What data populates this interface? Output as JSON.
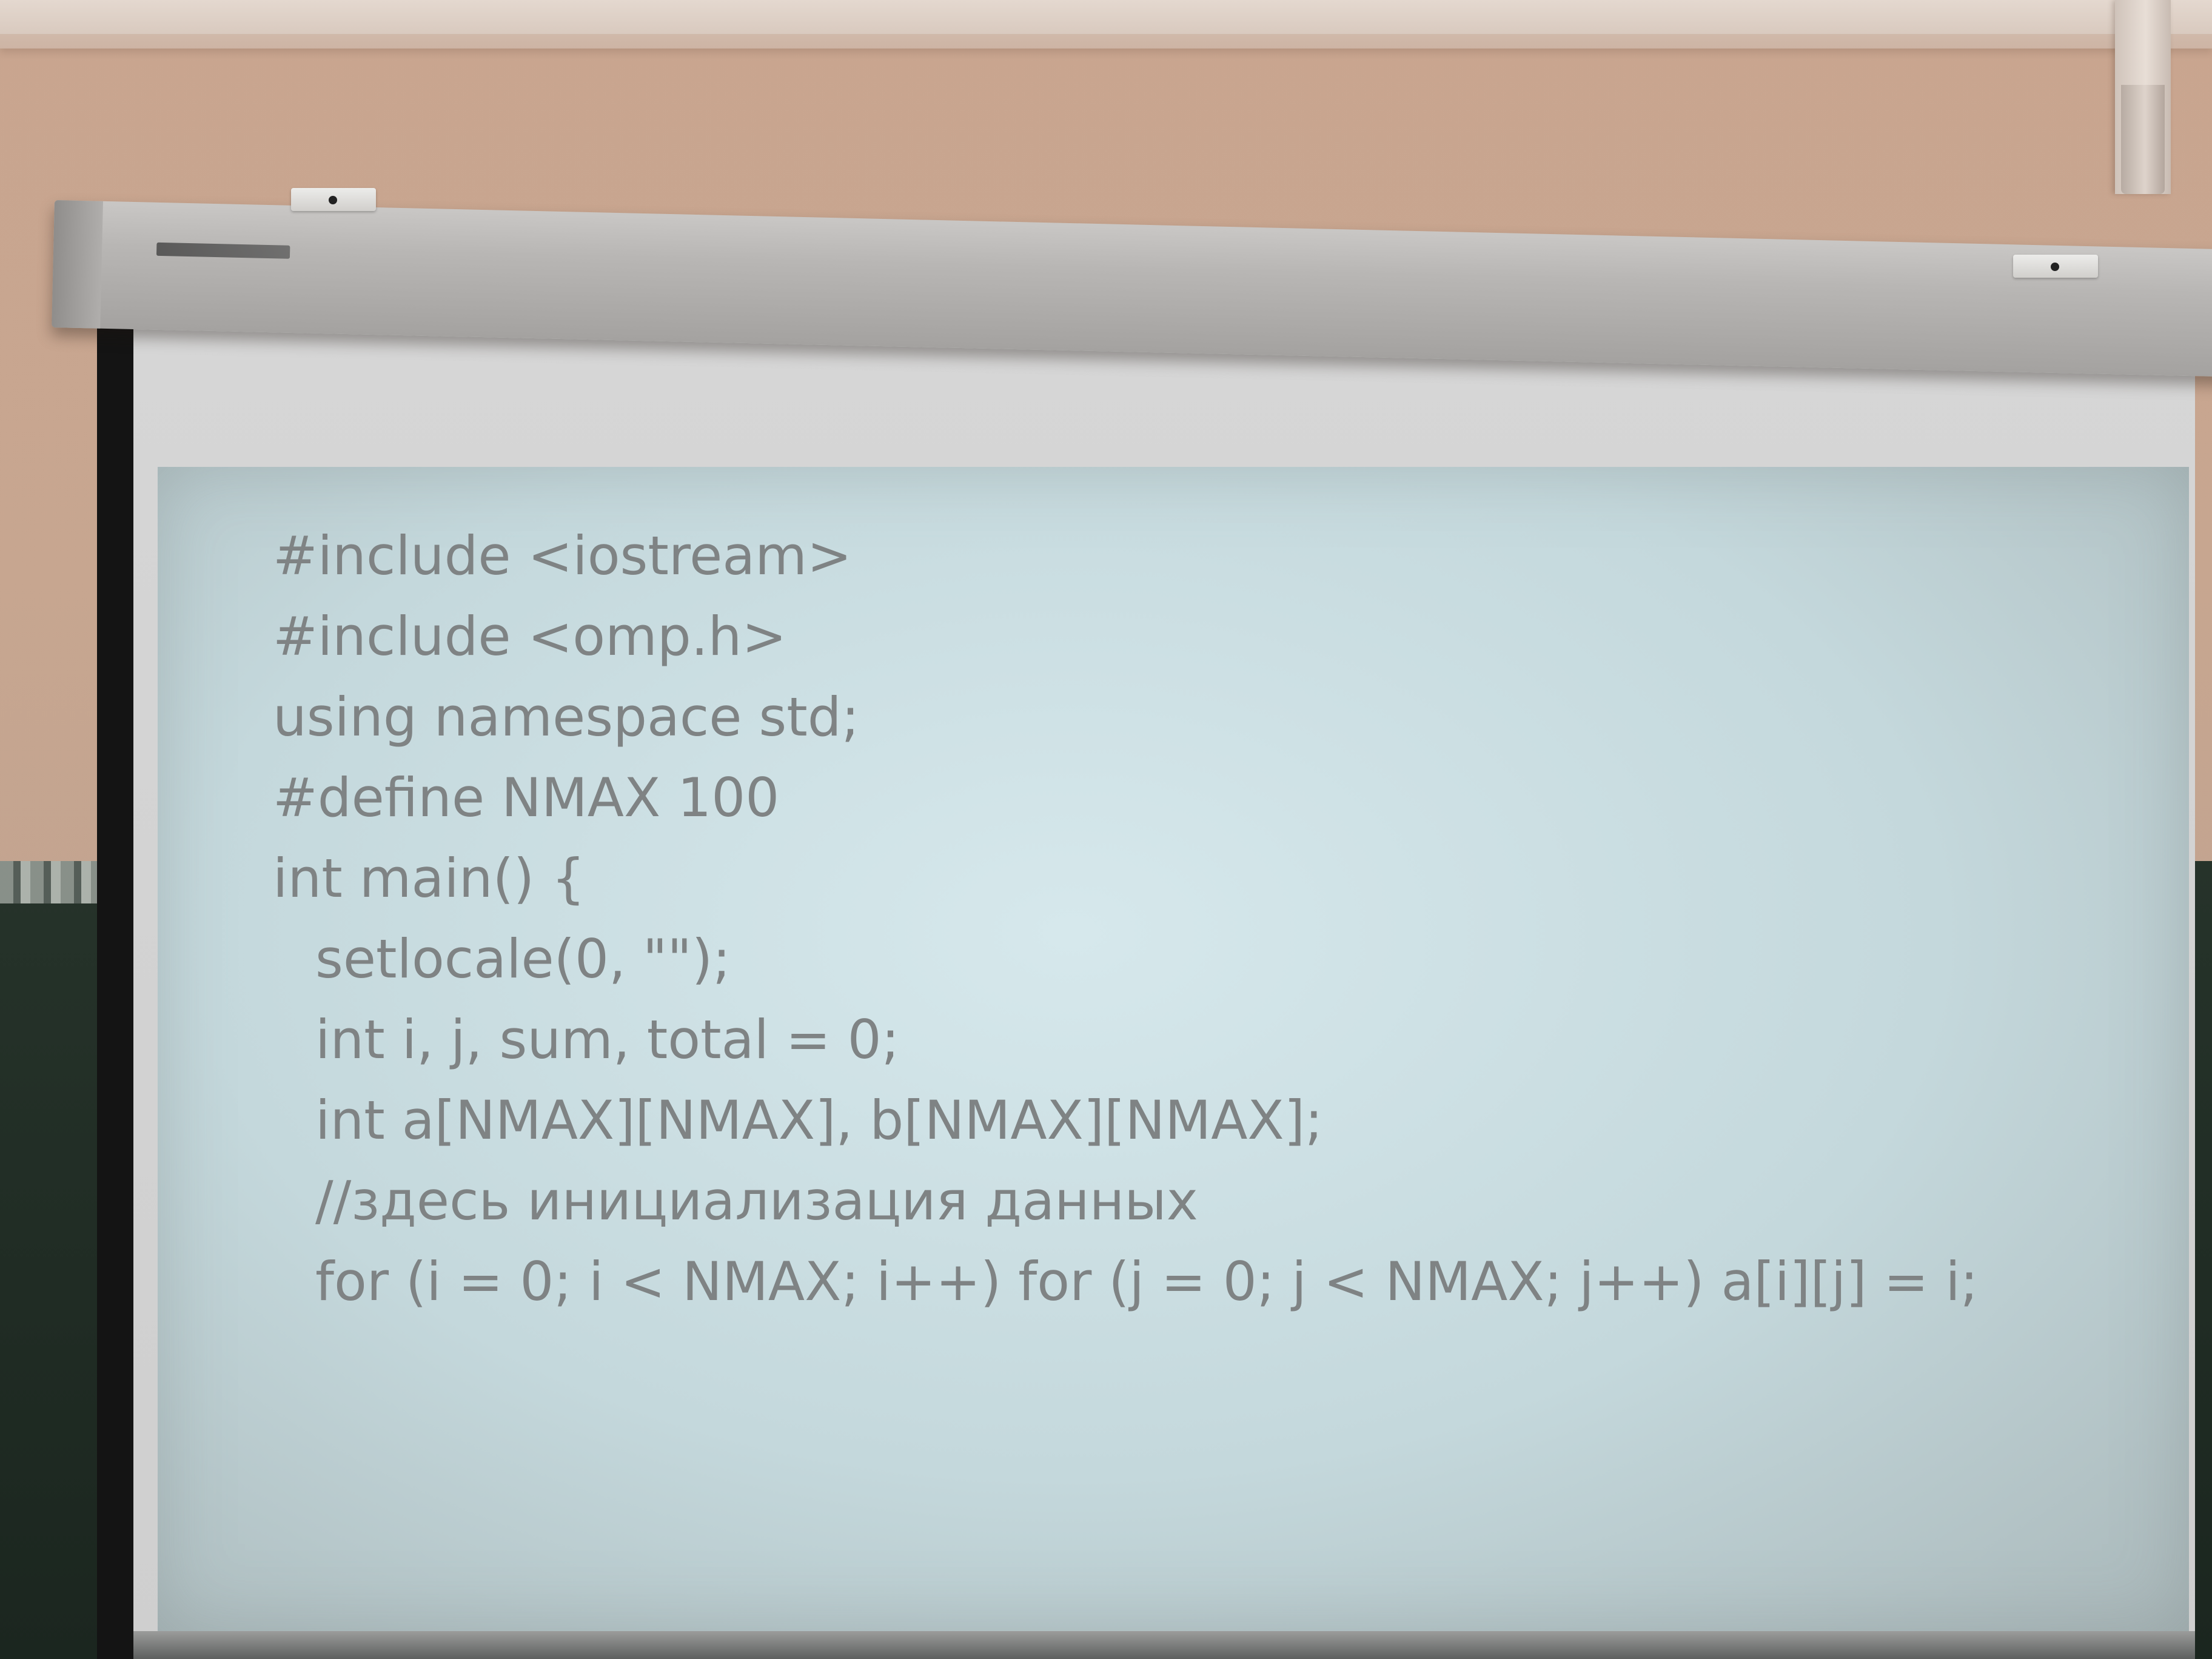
{
  "slide": {
    "code_lines": [
      {
        "text": "#include <iostream>"
      },
      {
        "text": "#include <omp.h>"
      },
      {
        "text": "using namespace std;"
      },
      {
        "text": "#define NMAX 100"
      },
      {
        "text": "int main() {"
      },
      {
        "text": "setlocale(0, \"\");"
      },
      {
        "text": "int i, j, sum, total = 0;"
      },
      {
        "text": "int a[NMAX][NMAX], b[NMAX][NMAX];"
      },
      {
        "text": "//здесь инициализация данных"
      },
      {
        "text": "for (i = 0; i < NMAX; i++) for (j = 0; j < NMAX; j++) a[i][j] = i;"
      }
    ]
  },
  "colors": {
    "slide_background": "#d2e4e7",
    "code_text": "#7f8384",
    "wall": "#c9a58f",
    "chalkboard": "#1f2b23",
    "screen_case": "#b8b6b4"
  }
}
